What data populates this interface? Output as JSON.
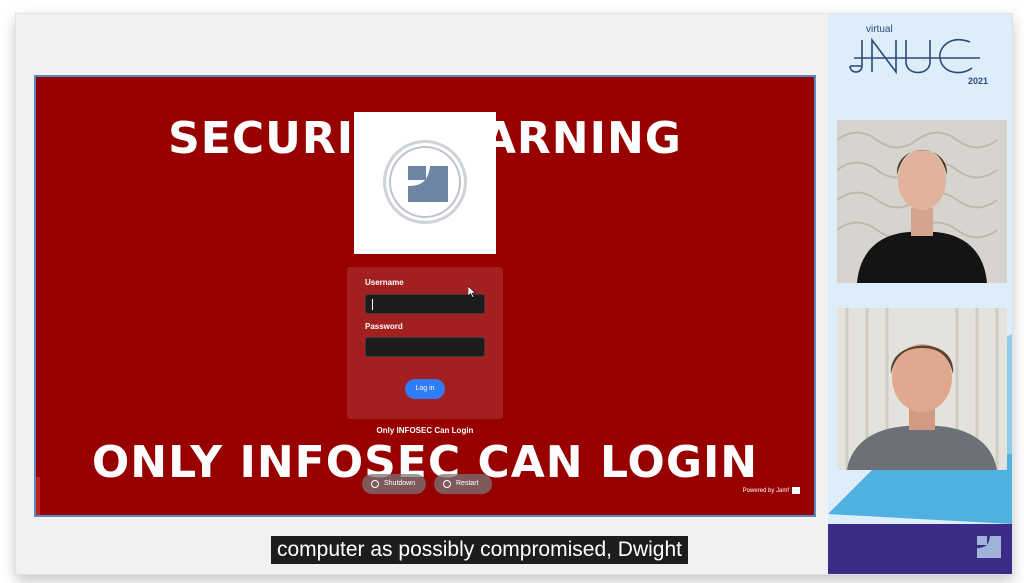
{
  "presentation": {
    "warning_top": "SECURITY WARNING",
    "warning_bottom": "ONLY INFOSEC CAN LOGIN",
    "login": {
      "username_label": "Username",
      "password_label": "Password",
      "login_button": "Log in"
    },
    "only_infosec_note": "Only INFOSEC Can Login",
    "shutdown_label": "Shutdown",
    "restart_label": "Restart",
    "powered_by": "Powered by Jamf"
  },
  "caption": "computer as possibly compromised, Dwight",
  "sidebar": {
    "virtual": "virtual",
    "brand": "JNUC",
    "year": "2021"
  },
  "colors": {
    "warning_background": "#980000",
    "login_button": "#2f7cf6",
    "sidebar": "#ddeefa",
    "brand_navy": "#2b4a7c"
  }
}
